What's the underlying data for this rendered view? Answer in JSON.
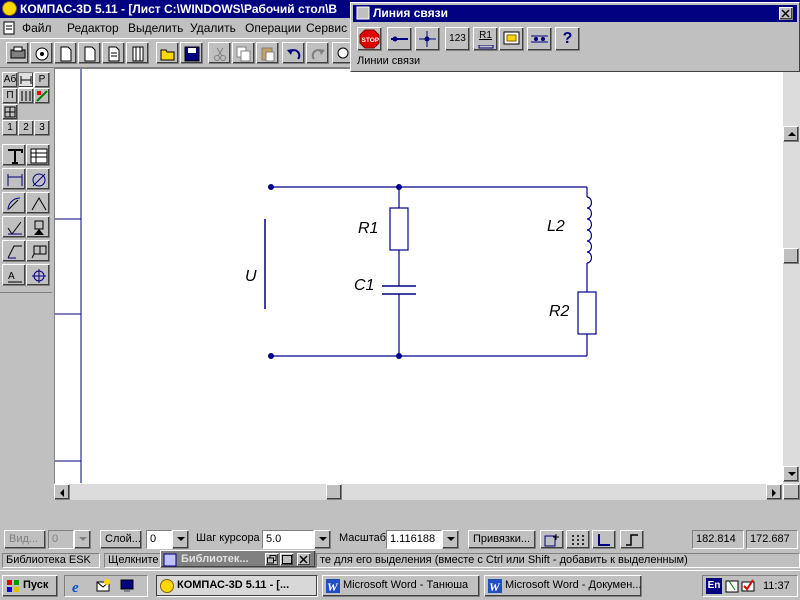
{
  "window": {
    "title": "КОМПАС-3D 5.11 - [Лист C:\\WINDOWS\\Рабочий стол\\В"
  },
  "menu": [
    {
      "label": "Файл"
    },
    {
      "label": "Редактор"
    },
    {
      "label": "Выделить"
    },
    {
      "label": "Удалить"
    },
    {
      "label": "Операции"
    },
    {
      "label": "Сервис"
    }
  ],
  "left_panel": {
    "tabs": [
      "1",
      "2",
      "3"
    ],
    "top_buttons": [
      "Аб",
      "Р",
      "П"
    ]
  },
  "schematic": {
    "labels": {
      "r1": "R1",
      "c1": "C1",
      "l2": "L2",
      "r2": "R2",
      "u": "U"
    }
  },
  "floating_window": {
    "title": "Линия связи",
    "status": "Линии связи",
    "buttons": [
      "STOP",
      "123",
      "R1",
      "?"
    ]
  },
  "properties": {
    "view_label": "Вид...",
    "view_value": "0",
    "layer_label": "Слой...",
    "layer_value": "0",
    "step_label": "Шаг курсора",
    "step_value": "5.0",
    "scale_label": "Масштаб",
    "scale_value": "1.116188",
    "snaps_label": "Привязки...",
    "coord_x": "182.814",
    "coord_y": "172.687"
  },
  "hint": {
    "library": "Библиотека ESK",
    "message_start": "Щелкните",
    "message_end": "те для его выделения (вместе с Ctrl или Shift - добавить к выделенным)",
    "library_window": "Библиотек..."
  },
  "taskbar": {
    "start": "Пуск",
    "tasks": [
      {
        "label": "КОМПАС-3D 5.11 - [...",
        "active": true
      },
      {
        "label": "Microsoft Word - Танюша",
        "active": false
      },
      {
        "label": "Microsoft Word - Докумен...",
        "active": false
      }
    ],
    "lang": "En",
    "clock": "11:37"
  },
  "colors": {
    "title_bg": "#000080",
    "schematic_stroke": "#00008b",
    "canvas_bg": "#ffffff"
  }
}
